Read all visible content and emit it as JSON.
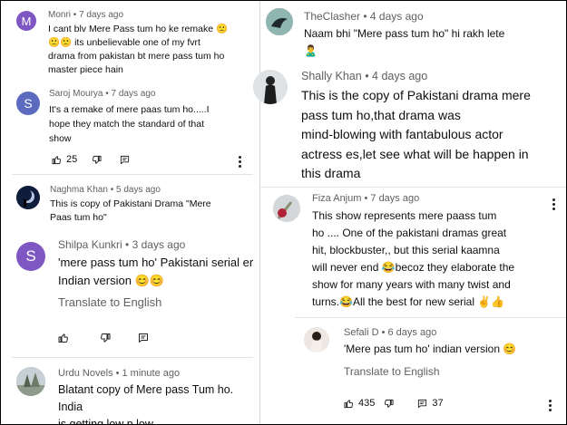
{
  "left": {
    "comments": [
      {
        "author": "Monri",
        "time": "7 days ago",
        "avatar_letter": "M",
        "avatar_color": "#7e57c2",
        "lines": [
          "I cant blv Mere Pass tum ho ke remake 🙁",
          "🙁🙁 its unbelievable one of my fvrt",
          "drama from pakistan bt mere pass tum ho",
          "master piece hain"
        ]
      },
      {
        "author": "Saroj Mourya",
        "time": "7 days ago",
        "avatar_letter": "S",
        "avatar_color": "#5c6bc0",
        "lines": [
          "It's a remake of mere paas tum ho.....I",
          "hope they match the standard of that",
          "show"
        ],
        "likes": "25"
      },
      {
        "author": "Naghma Khan",
        "time": "5 days ago",
        "lines": [
          "This is copy of Pakistani Drama \"Mere",
          "Paas tum ho\""
        ]
      },
      {
        "author": "Shilpa Kunkri",
        "time": "3 days ago",
        "avatar_letter": "S",
        "avatar_color": "#7e57c2",
        "lines": [
          "'mere pass tum ho' Pakistani serial er",
          "Indian version 😊😊"
        ],
        "translate": "Translate to English"
      },
      {
        "author": "Urdu Novels",
        "time": "1 minute ago",
        "lines": [
          "Blatant copy of Mere pass Tum ho. India",
          "is getting low n low"
        ]
      }
    ]
  },
  "right": {
    "comments": [
      {
        "author": "TheClasher",
        "time": "4 days ago",
        "lines": [
          "Naam bhi \"Mere pass tum ho\"  hi rakh lete",
          "🙎‍♂️"
        ]
      },
      {
        "author": "Shally Khan",
        "time": "4 days ago",
        "lines": [
          "This is the copy of Pakistani drama mere",
          "pass tum ho,that drama was",
          "mind-blowing with fantabulous actor",
          "actress es,let see what will be happen in",
          "this drama"
        ]
      },
      {
        "author": "Fiza Anjum",
        "time": "7 days ago",
        "lines": [
          "This show represents mere paass tum",
          "ho .... One of the pakistani dramas great",
          "hit, blockbuster,, but this serial kaamna",
          "will never end 😂becoz they elaborate the",
          "show for many years with many twist and",
          "turns.😂All the best for new serial ✌️👍"
        ]
      },
      {
        "author": "Sefali D",
        "time": "6 days ago",
        "lines": [
          "'Mere pas tum ho' indian version 😊"
        ],
        "translate": "Translate to English",
        "likes": "435",
        "replies": "37"
      }
    ]
  }
}
